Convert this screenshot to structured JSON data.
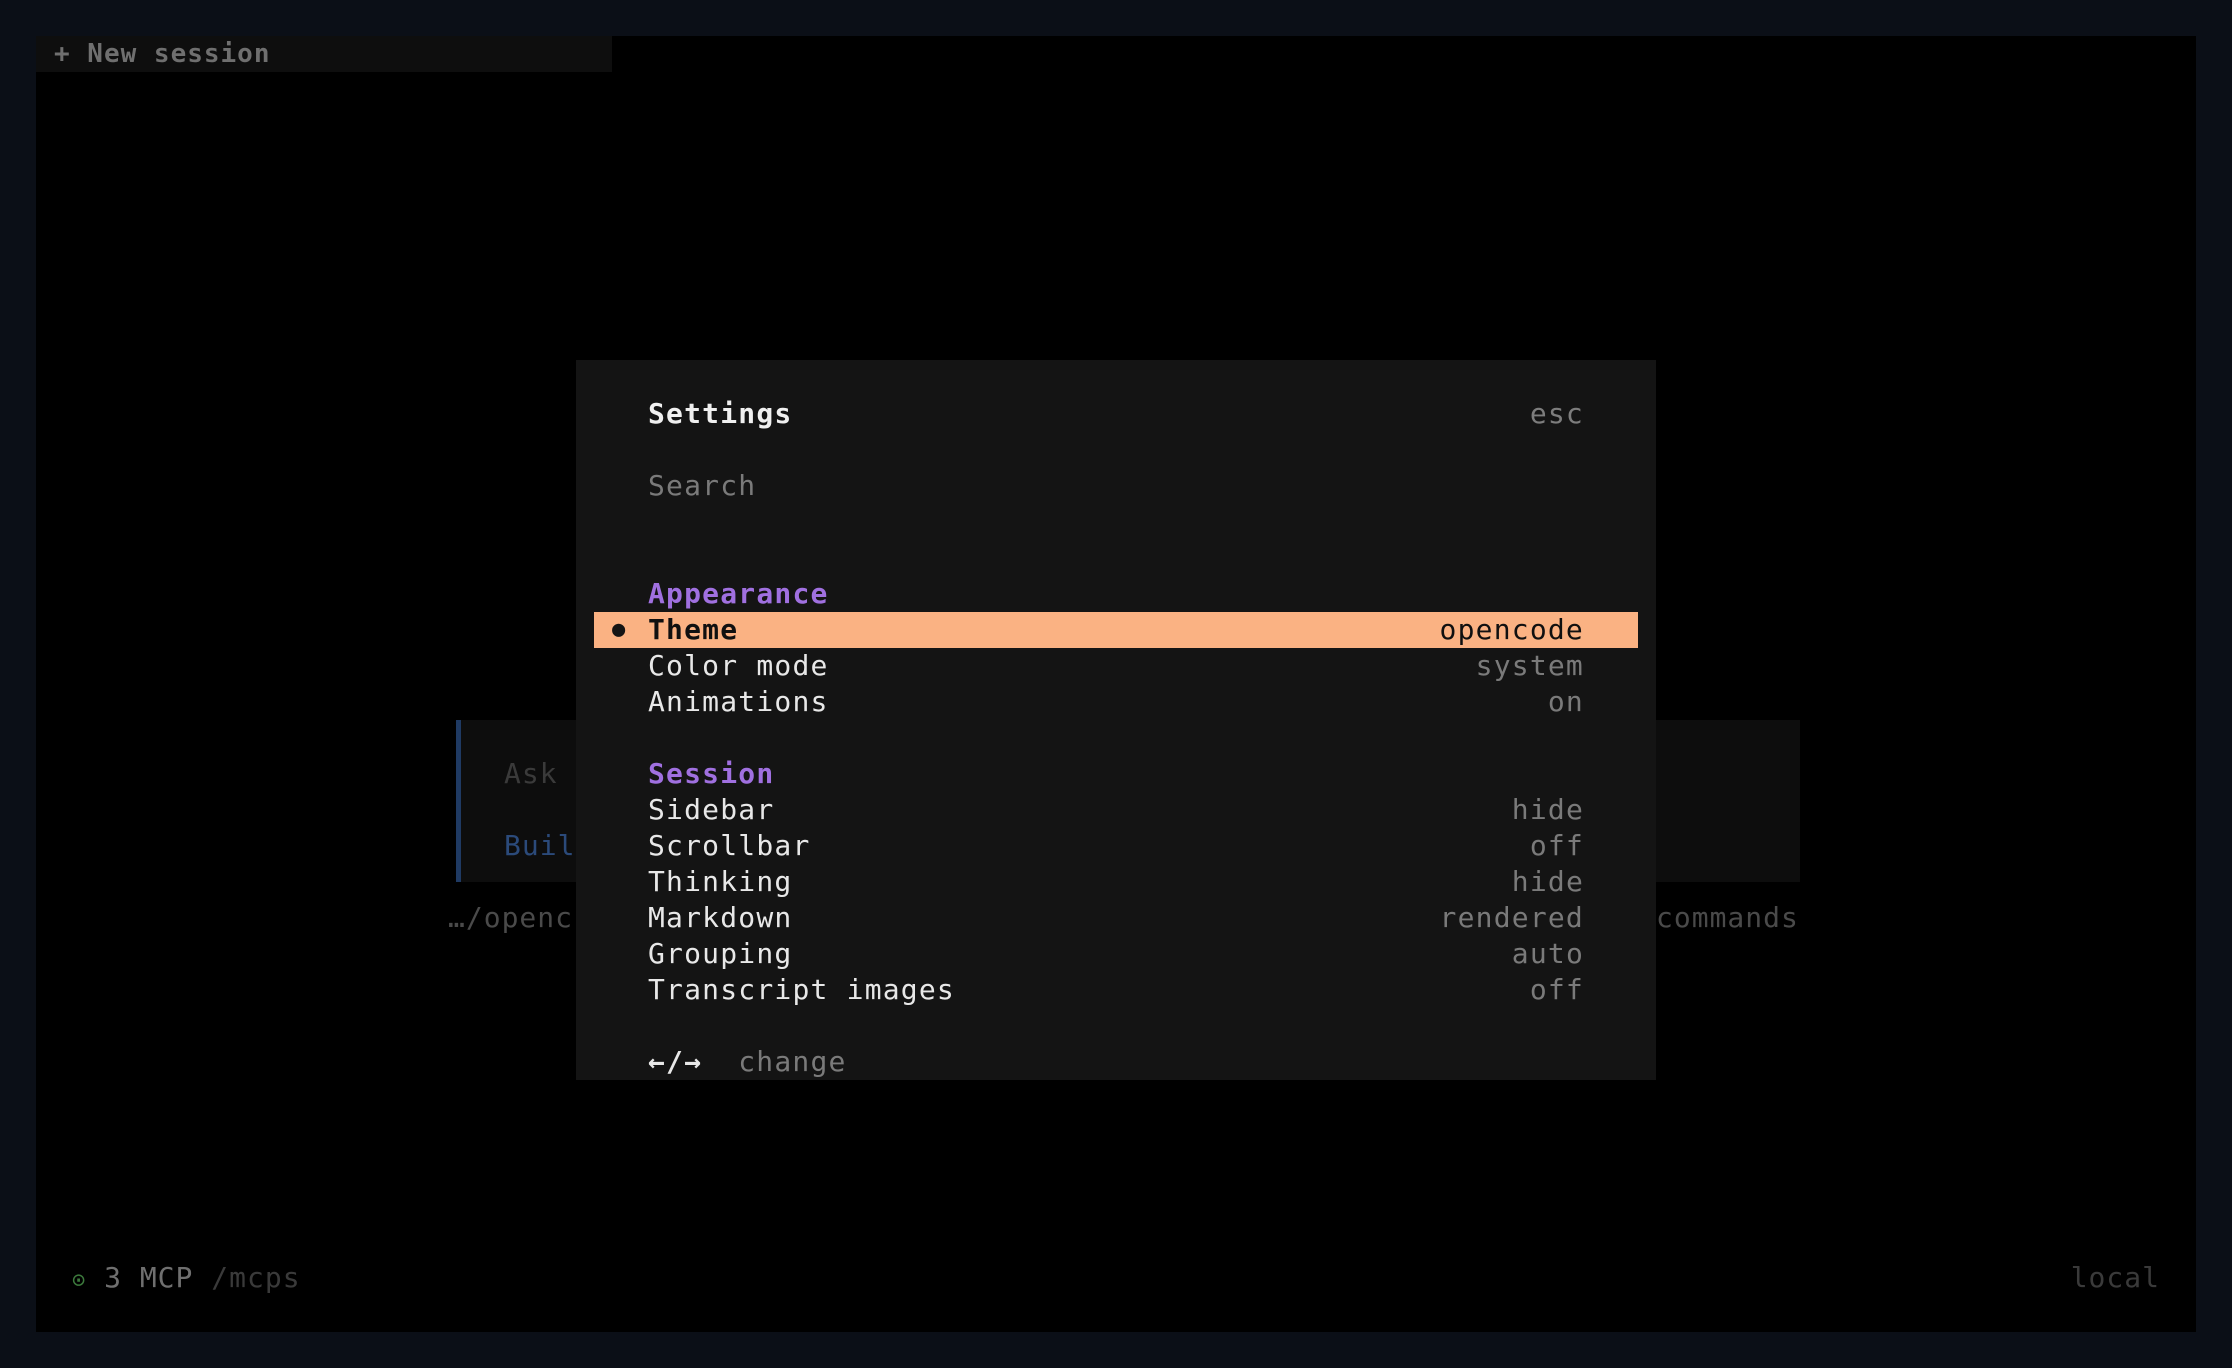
{
  "top_bar": {
    "new_session_label": "+ New session"
  },
  "background": {
    "prompt_placeholder": "Ask",
    "agent_label": "Buil",
    "cwd": "…/openc",
    "commands_hint": "commands"
  },
  "status_bar": {
    "mcp_icon": "circle-dot-icon",
    "mcp_count": "3 MCP",
    "mcp_command": "/mcps",
    "right_label": "local"
  },
  "settings": {
    "title": "Settings",
    "close_hint": "esc",
    "search_placeholder": "Search",
    "sections": [
      {
        "name": "Appearance",
        "items": [
          {
            "label": "Theme",
            "value": "opencode",
            "selected": true
          },
          {
            "label": "Color mode",
            "value": "system"
          },
          {
            "label": "Animations",
            "value": "on"
          }
        ]
      },
      {
        "name": "Session",
        "items": [
          {
            "label": "Sidebar",
            "value": "hide"
          },
          {
            "label": "Scrollbar",
            "value": "off"
          },
          {
            "label": "Thinking",
            "value": "hide"
          },
          {
            "label": "Markdown",
            "value": "rendered"
          },
          {
            "label": "Grouping",
            "value": "auto"
          },
          {
            "label": "Transcript images",
            "value": "off"
          }
        ]
      }
    ],
    "footer": {
      "keys": "←/→",
      "action": "change"
    }
  },
  "colors": {
    "accent_selected": "#fab283",
    "section_heading": "#a070e0",
    "modal_background": "#141414",
    "frame_background": "#000000"
  }
}
